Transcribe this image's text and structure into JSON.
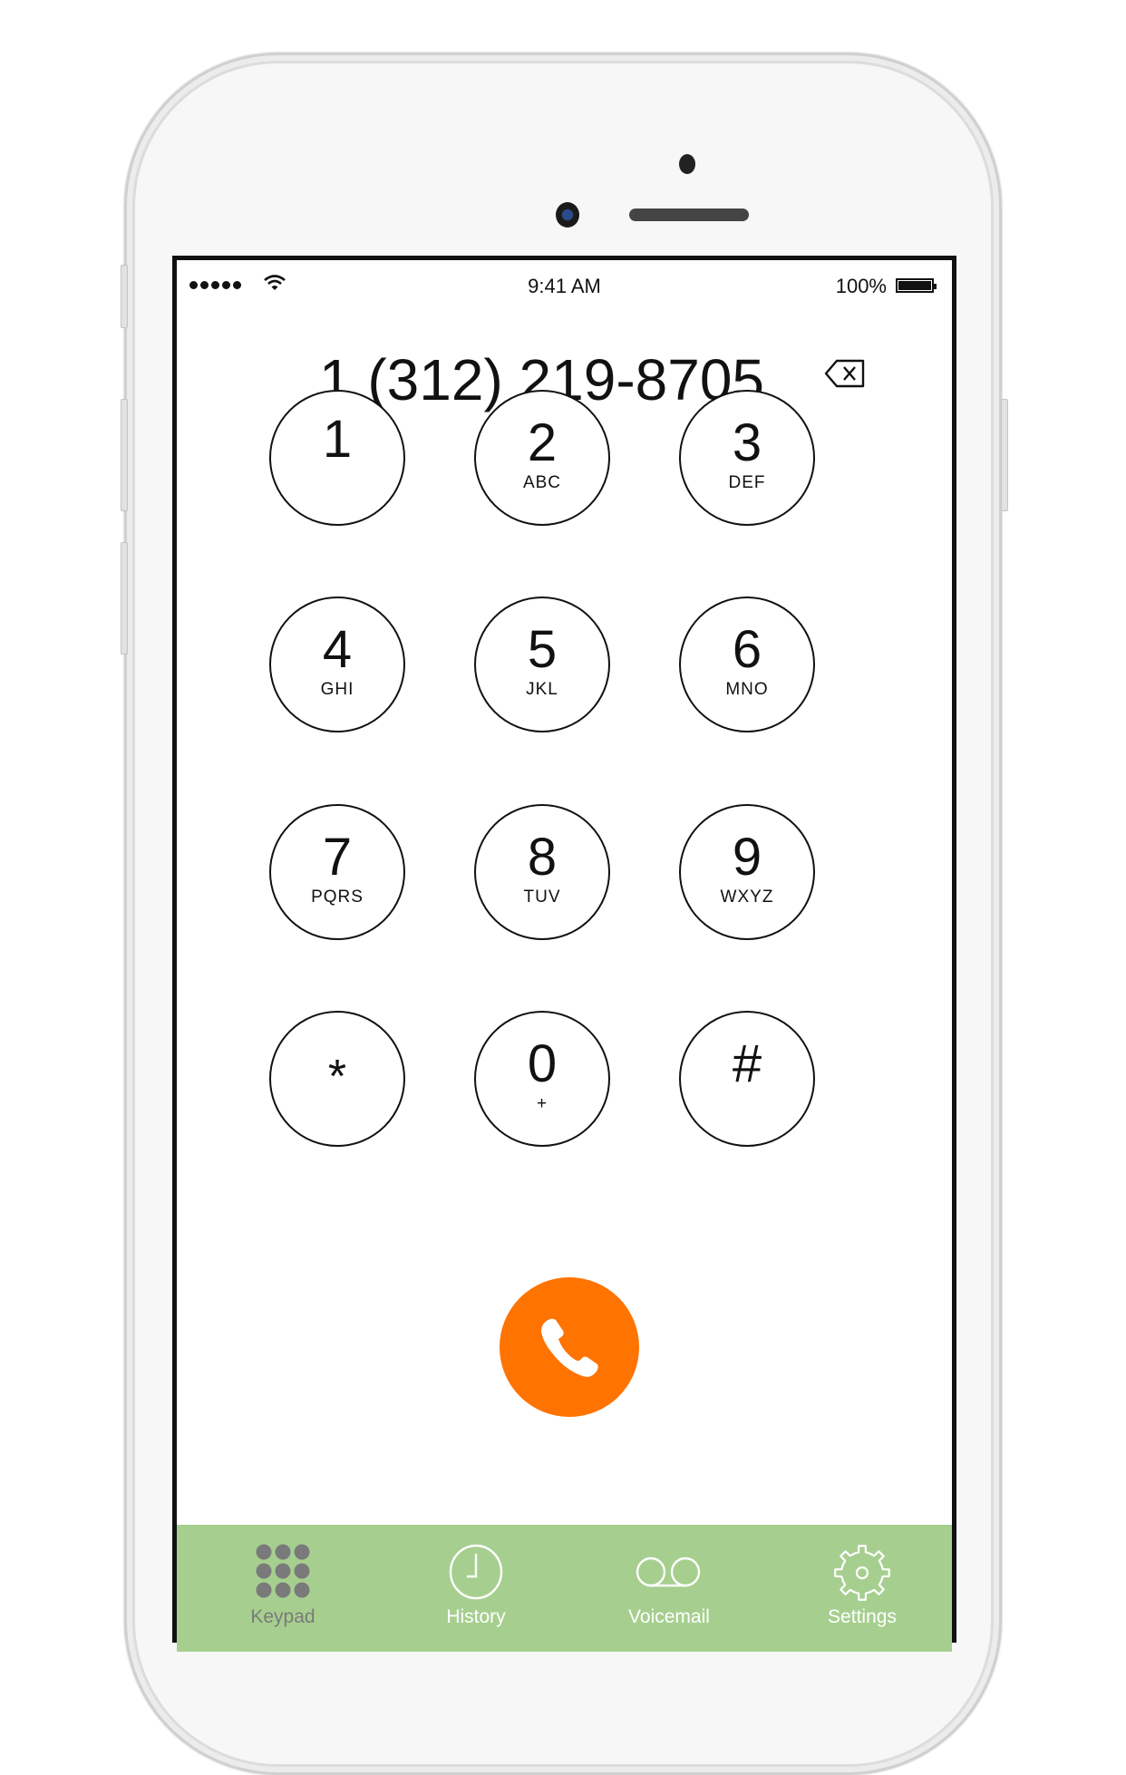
{
  "status_bar": {
    "signal_icon": "signal-dots-icon",
    "wifi_icon": "wifi-icon",
    "time": "9:41 AM",
    "battery_percent": "100%",
    "battery_icon": "battery-full-icon"
  },
  "dialer": {
    "number": "1 (312) 219-8705",
    "backspace_icon": "backspace-icon"
  },
  "keypad": {
    "keys": [
      {
        "digit": "1",
        "letters": ""
      },
      {
        "digit": "2",
        "letters": "ABC"
      },
      {
        "digit": "3",
        "letters": "DEF"
      },
      {
        "digit": "4",
        "letters": "GHI"
      },
      {
        "digit": "5",
        "letters": "JKL"
      },
      {
        "digit": "6",
        "letters": "MNO"
      },
      {
        "digit": "7",
        "letters": "PQRS"
      },
      {
        "digit": "8",
        "letters": "TUV"
      },
      {
        "digit": "9",
        "letters": "WXYZ"
      },
      {
        "digit": "*",
        "letters": ""
      },
      {
        "digit": "0",
        "letters": "+"
      },
      {
        "digit": "#",
        "letters": ""
      }
    ]
  },
  "call_button": {
    "icon": "phone-icon",
    "color": "#FF7300"
  },
  "tab_bar": {
    "background": "#A6CF8F",
    "tabs": [
      {
        "label": "Keypad",
        "icon": "keypad-icon",
        "active": true
      },
      {
        "label": "History",
        "icon": "clock-icon",
        "active": false
      },
      {
        "label": "Voicemail",
        "icon": "voicemail-icon",
        "active": false
      },
      {
        "label": "Settings",
        "icon": "gear-icon",
        "active": false
      }
    ]
  }
}
